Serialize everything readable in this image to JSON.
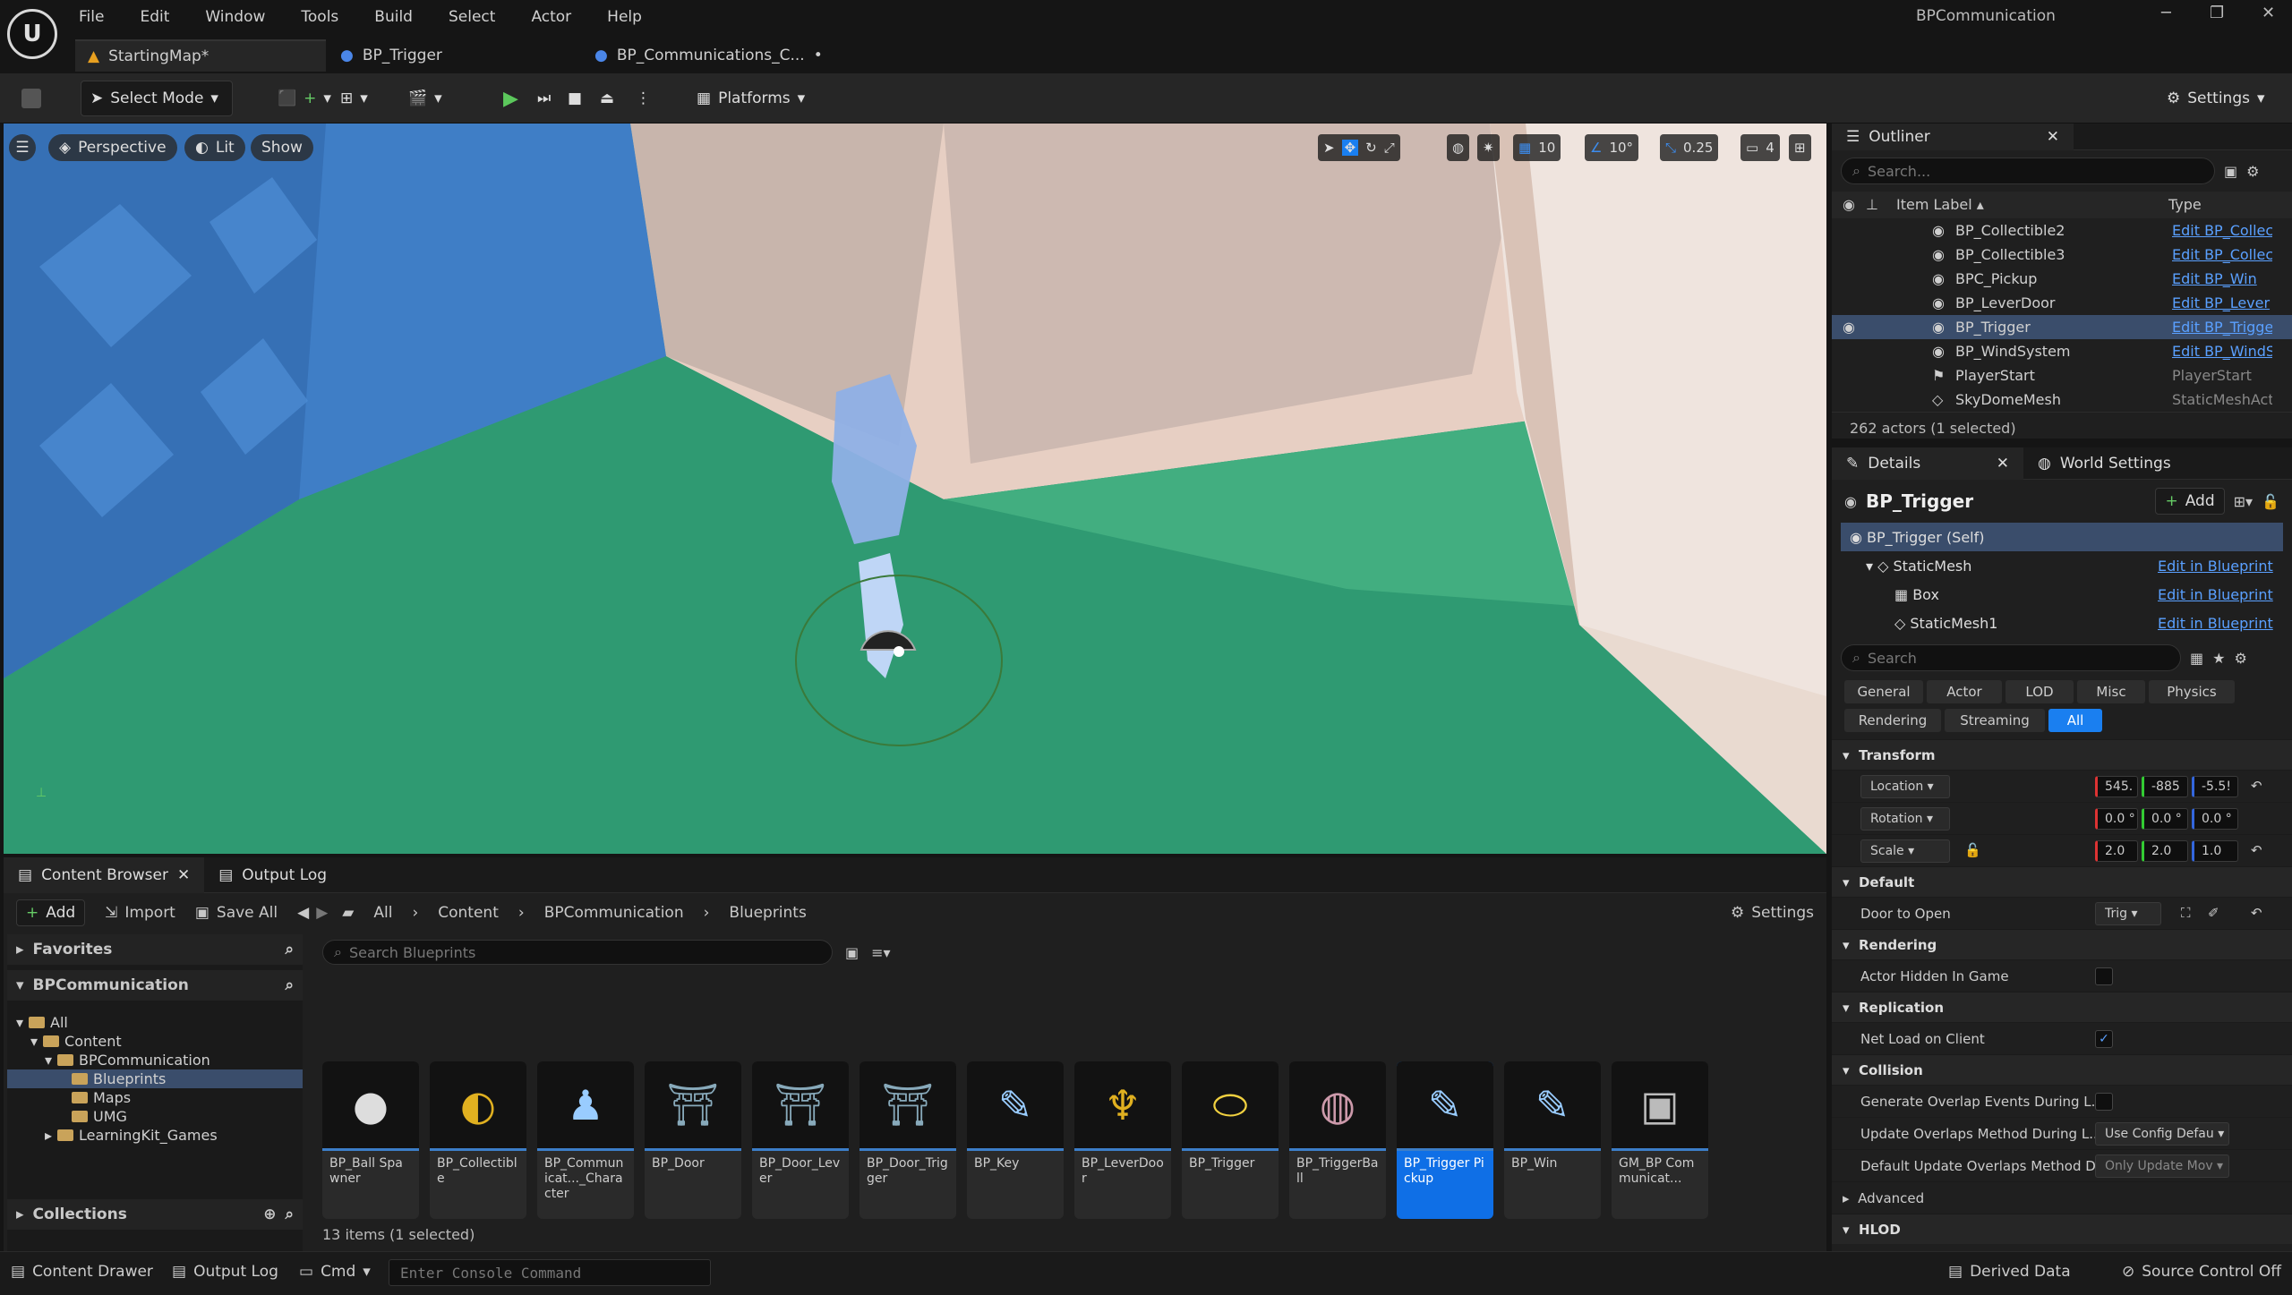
{
  "app": {
    "logo": "U",
    "window_title": "BPCommunication"
  },
  "menu": [
    "File",
    "Edit",
    "Window",
    "Tools",
    "Build",
    "Select",
    "Actor",
    "Help"
  ],
  "doc_tabs": [
    {
      "label": "StartingMap*",
      "icon": "map-icon"
    },
    {
      "label": "BP_Trigger",
      "icon": "blueprint-icon"
    },
    {
      "label": "BP_Communications_C...",
      "icon": "blueprint-icon"
    }
  ],
  "toolbar": {
    "select_mode": "Select Mode",
    "platforms": "Platforms",
    "settings": "Settings"
  },
  "viewport": {
    "perspective": "Perspective",
    "lit": "Lit",
    "show": "Show",
    "grid_snap": "10",
    "rot_snap": "10°",
    "scale_snap": "0.25",
    "cam_speed": "4"
  },
  "outliner": {
    "title": "Outliner",
    "search_placeholder": "Search...",
    "col_label": "Item Label ▴",
    "col_type": "Type",
    "rows": [
      {
        "label": "BP_Collectible2",
        "type": "Edit BP_Collec"
      },
      {
        "label": "BP_Collectible3",
        "type": "Edit BP_Collec"
      },
      {
        "label": "BPC_Pickup",
        "type": "Edit BP_Win"
      },
      {
        "label": "BP_LeverDoor",
        "type": "Edit BP_Lever"
      },
      {
        "label": "BP_Trigger",
        "type": "Edit BP_Trigge"
      },
      {
        "label": "BP_WindSystem",
        "type": "Edit BP_WindS"
      },
      {
        "label": "PlayerStart",
        "type": "PlayerStart"
      },
      {
        "label": "SkyDomeMesh",
        "type": "StaticMeshAct"
      }
    ],
    "status": "262 actors (1 selected)"
  },
  "details": {
    "tab": "Details",
    "tab2": "World Settings",
    "actor": "BP_Trigger",
    "add": "Add",
    "components": [
      {
        "label": "BP_Trigger (Self)",
        "edit": ""
      },
      {
        "label": "StaticMesh",
        "edit": "Edit in Blueprint"
      },
      {
        "label": "Box",
        "edit": "Edit in Blueprint"
      },
      {
        "label": "StaticMesh1",
        "edit": "Edit in Blueprint"
      }
    ],
    "search_placeholder": "Search",
    "filters_row1": [
      "General",
      "Actor",
      "LOD",
      "Misc",
      "Physics"
    ],
    "filters_row2": [
      "Rendering",
      "Streaming",
      "All"
    ],
    "transform": {
      "title": "Transform",
      "location": {
        "label": "Location",
        "x": "545.",
        "y": "-885",
        "z": "-5.5!"
      },
      "rotation": {
        "label": "Rotation",
        "x": "0.0 °",
        "y": "0.0 °",
        "z": "0.0 °"
      },
      "scale": {
        "label": "Scale",
        "x": "2.0",
        "y": "2.0",
        "z": "1.0"
      }
    },
    "default": {
      "title": "Default",
      "door_label": "Door to Open",
      "door_value": "Trig"
    },
    "rendering": {
      "title": "Rendering",
      "hidden_label": "Actor Hidden In Game"
    },
    "replication": {
      "title": "Replication",
      "net_label": "Net Load on Client"
    },
    "collision": {
      "title": "Collision",
      "gen_label": "Generate Overlap Events During L...",
      "upd_label": "Update Overlaps Method During L...",
      "upd_value": "Use Config Defau",
      "def_label": "Default Update Overlaps Method D...",
      "def_value": "Only Update Mov",
      "advanced": "Advanced"
    },
    "hlod": "HLOD"
  },
  "content_browser": {
    "tab": "Content Browser",
    "tab2": "Output Log",
    "add": "Add",
    "import": "Import",
    "save_all": "Save All",
    "crumbs": [
      "All",
      "Content",
      "BPCommunication",
      "Blueprints"
    ],
    "settings": "Settings",
    "favorites": "Favorites",
    "project": "BPCommunication",
    "tree": [
      {
        "label": "All",
        "indent": 0
      },
      {
        "label": "Content",
        "indent": 1
      },
      {
        "label": "BPCommunication",
        "indent": 2
      },
      {
        "label": "Blueprints",
        "indent": 3
      },
      {
        "label": "Maps",
        "indent": 3
      },
      {
        "label": "UMG",
        "indent": 3
      },
      {
        "label": "LearningKit_Games",
        "indent": 2
      }
    ],
    "collections": "Collections",
    "search_placeholder": "Search Blueprints",
    "assets": [
      {
        "name": "BP_Ball Spawner",
        "glyph": "●"
      },
      {
        "name": "BP_Collectible",
        "glyph": "◐"
      },
      {
        "name": "BP_Communicat..._Character",
        "glyph": "♟"
      },
      {
        "name": "BP_Door",
        "glyph": "⛩"
      },
      {
        "name": "BP_Door_Lever",
        "glyph": "⛩"
      },
      {
        "name": "BP_Door_Trigger",
        "glyph": "⛩"
      },
      {
        "name": "BP_Key",
        "glyph": "✎"
      },
      {
        "name": "BP_LeverDoor",
        "glyph": "♆"
      },
      {
        "name": "BP_Trigger",
        "glyph": "⬭"
      },
      {
        "name": "BP_TriggerBall",
        "glyph": "◍"
      },
      {
        "name": "BP_Trigger Pickup",
        "glyph": "✎"
      },
      {
        "name": "BP_Win",
        "glyph": "✎"
      },
      {
        "name": "GM_BP Communicat...",
        "glyph": "▣"
      }
    ],
    "count": "13 items (1 selected)"
  },
  "status": {
    "drawer": "Content Drawer",
    "output": "Output Log",
    "cmd": "Cmd",
    "console_placeholder": "Enter Console Command",
    "derived": "Derived Data",
    "scc": "Source Control Off"
  }
}
